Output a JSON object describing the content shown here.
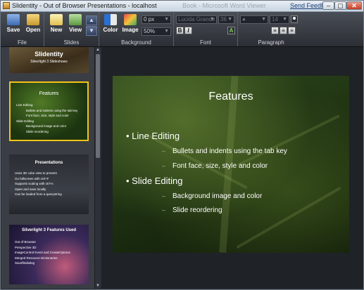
{
  "window": {
    "title": "Slidentity - Out of Browser Presentations - localhost",
    "ghost_title": "Book - Microsoft Word Viewer",
    "feedback_link": "Send Feedback",
    "minimize": "–",
    "maximize": "▢",
    "close": "✕"
  },
  "ribbon": {
    "groups": {
      "file": "File",
      "slides": "Slides",
      "background": "Background",
      "font": "Font",
      "paragraph": "Paragraph"
    },
    "buttons": {
      "save": "Save",
      "open": "Open",
      "new": "New",
      "view": "View",
      "color": "Color",
      "image": "Image",
      "up": "▲",
      "down": "▼",
      "bold": "B",
      "italic": "I",
      "font_color": "A"
    },
    "offset_value": "0 px",
    "zoom_value": "50%",
    "font_family": "Lucida Grande",
    "font_size": "36",
    "para_style": "●",
    "para_size": "14",
    "accent_color": "#4a9c2a"
  },
  "thumbnails": [
    {
      "title": "Slidentity",
      "subtitle": "Silverlight 3 Slideshows",
      "bullets": []
    },
    {
      "title": "Features",
      "bullets": [
        "Line Editing",
        "Bullets and indents using the tab key",
        "Font face, size, style and color",
        "Slide Editing",
        "Background image and color",
        "Slide reordering"
      ]
    },
    {
      "title": "Presentations",
      "bullets": [
        "Uses 3D cube view to present",
        "Go fullscreen with ctrl+F",
        "Supports scaling with ctrl+s",
        "Open and save locally",
        "Can be loaded from a querystring"
      ]
    },
    {
      "title": "Silverlight 3 Features Used",
      "bullets": [
        "Out of Browser",
        "Perspective 3D",
        "ImageControl Event and CreateOptions",
        "Merged Resource Dictionaries",
        "Savefiledialog"
      ]
    }
  ],
  "slide": {
    "title": "Features",
    "bullets": [
      {
        "level": 1,
        "text": "Line Editing"
      },
      {
        "level": 2,
        "text": "Bullets and indents using the tab key"
      },
      {
        "level": 2,
        "text": "Font face, size, style and color"
      },
      {
        "level": 1,
        "text": "Slide Editing"
      },
      {
        "level": 2,
        "text": "Background image and color"
      },
      {
        "level": 2,
        "text": "Slide reordering"
      }
    ]
  }
}
